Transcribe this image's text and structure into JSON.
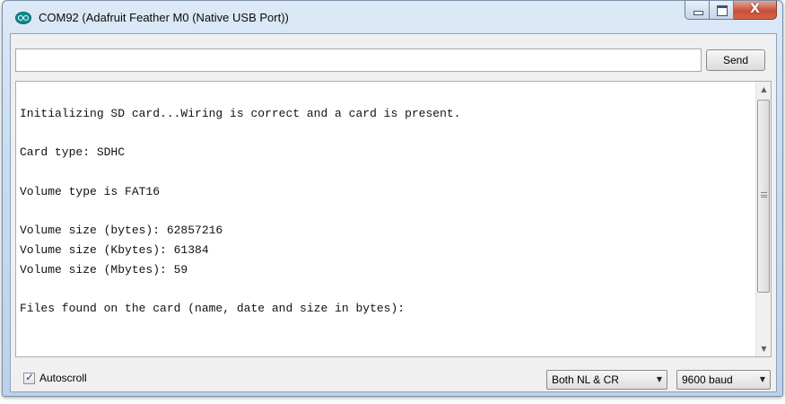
{
  "window": {
    "title": "COM92 (Adafruit Feather M0 (Native USB Port))",
    "icon": "arduino-icon"
  },
  "controls": {
    "close_glyph": "X"
  },
  "send": {
    "input_value": "",
    "button_label": "Send"
  },
  "output": {
    "lines": [
      "Initializing SD card...Wiring is correct and a card is present.",
      "",
      "Card type: SDHC",
      "",
      "Volume type is FAT16",
      "",
      "Volume size (bytes): 62857216",
      "Volume size (Kbytes): 61384",
      "Volume size (Mbytes): 59",
      "",
      "Files found on the card (name, date and size in bytes):"
    ]
  },
  "footer": {
    "autoscroll_label": "Autoscroll",
    "autoscroll_checked": true,
    "line_ending": "Both NL & CR",
    "baud_rate": "9600 baud"
  },
  "colors": {
    "accent": "#0d8b8e",
    "close_button": "#c7503a"
  }
}
